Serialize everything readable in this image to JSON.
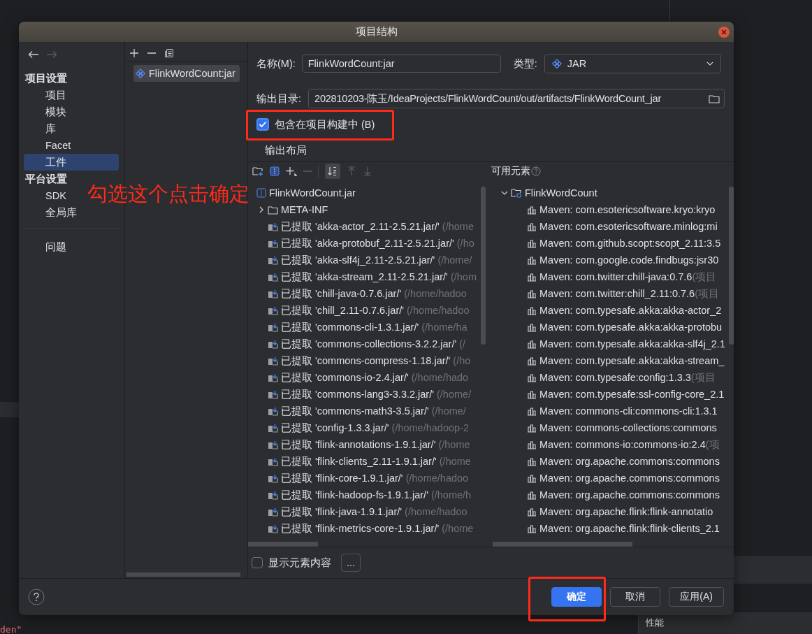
{
  "background": {
    "editor_fragment": "den\"",
    "side_panel_item": "性能"
  },
  "dialog": {
    "title": "项目结构"
  },
  "sidebar": {
    "sections": [
      {
        "heading": "项目设置",
        "items": [
          {
            "label": "项目",
            "selected": false
          },
          {
            "label": "模块",
            "selected": false
          },
          {
            "label": "库",
            "selected": false
          },
          {
            "label": "Facet",
            "selected": false
          },
          {
            "label": "工件",
            "selected": true
          }
        ]
      },
      {
        "heading": "平台设置",
        "items": [
          {
            "label": "SDK",
            "selected": false
          },
          {
            "label": "全局库",
            "selected": false
          }
        ]
      }
    ],
    "extra_items": [
      {
        "label": "问题",
        "selected": false
      }
    ]
  },
  "artifacts": [
    {
      "label": "FlinkWordCount:jar",
      "selected": true
    }
  ],
  "form": {
    "name_label": "名称(M):",
    "name_value": "FlinkWordCount:jar",
    "type_label": "类型:",
    "type_value": "JAR",
    "output_label": "输出目录:",
    "output_value": "202810203-陈玉/IdeaProjects/FlinkWordCount/out/artifacts/FlinkWordCount_jar",
    "include": {
      "label": "包含在项目构建中 (B)",
      "checked": true
    }
  },
  "layout_title": "输出布局",
  "available_title": "可用元素",
  "output_tree": {
    "label": "FlinkWordCount.jar",
    "children": [
      {
        "kind": "folder",
        "label": "META-INF",
        "expanded": false
      },
      {
        "kind": "extracted",
        "label": "已提取 'akka-actor_2.11-2.5.21.jar/'",
        "path": "(/home"
      },
      {
        "kind": "extracted",
        "label": "已提取 'akka-protobuf_2.11-2.5.21.jar/'",
        "path": "(/ho"
      },
      {
        "kind": "extracted",
        "label": "已提取 'akka-slf4j_2.11-2.5.21.jar/'",
        "path": "(/home/"
      },
      {
        "kind": "extracted",
        "label": "已提取 'akka-stream_2.11-2.5.21.jar/'",
        "path": "(/hom"
      },
      {
        "kind": "extracted",
        "label": "已提取 'chill-java-0.7.6.jar/'",
        "path": "(/home/hadoo"
      },
      {
        "kind": "extracted",
        "label": "已提取 'chill_2.11-0.7.6.jar/'",
        "path": "(/home/hadoo"
      },
      {
        "kind": "extracted",
        "label": "已提取 'commons-cli-1.3.1.jar/'",
        "path": "(/home/ha"
      },
      {
        "kind": "extracted",
        "label": "已提取 'commons-collections-3.2.2.jar/'",
        "path": "(/"
      },
      {
        "kind": "extracted",
        "label": "已提取 'commons-compress-1.18.jar/'",
        "path": "(/ho"
      },
      {
        "kind": "extracted",
        "label": "已提取 'commons-io-2.4.jar/'",
        "path": "(/home/hado"
      },
      {
        "kind": "extracted",
        "label": "已提取 'commons-lang3-3.3.2.jar/'",
        "path": "(/home/"
      },
      {
        "kind": "extracted",
        "label": "已提取 'commons-math3-3.5.jar/'",
        "path": "(/home/"
      },
      {
        "kind": "extracted",
        "label": "已提取 'config-1.3.3.jar/'",
        "path": "(/home/hadoop-2"
      },
      {
        "kind": "extracted",
        "label": "已提取 'flink-annotations-1.9.1.jar/'",
        "path": "(/home"
      },
      {
        "kind": "extracted",
        "label": "已提取 'flink-clients_2.11-1.9.1.jar/'",
        "path": "(/home"
      },
      {
        "kind": "extracted",
        "label": "已提取 'flink-core-1.9.1.jar/'",
        "path": "(/home/hadoo"
      },
      {
        "kind": "extracted",
        "label": "已提取 'flink-hadoop-fs-1.9.1.jar/'",
        "path": "(/home/h"
      },
      {
        "kind": "extracted",
        "label": "已提取 'flink-java-1.9.1.jar/'",
        "path": "(/home/hadoo"
      },
      {
        "kind": "extracted",
        "label": "已提取 'flink-metrics-core-1.9.1.jar/'",
        "path": "(/home"
      }
    ]
  },
  "available_tree": {
    "label": "FlinkWordCount",
    "expanded": true,
    "children": [
      {
        "label": "Maven: com.esotericsoftware.kryo:kryo"
      },
      {
        "label": "Maven: com.esotericsoftware.minlog:mi"
      },
      {
        "label": "Maven: com.github.scopt:scopt_2.11:3.5"
      },
      {
        "label": "Maven: com.google.code.findbugs:jsr30"
      },
      {
        "label": "Maven: com.twitter:chill-java:0.7.6",
        "note": "(项目"
      },
      {
        "label": "Maven: com.twitter:chill_2.11:0.7.6",
        "note": "(项目"
      },
      {
        "label": "Maven: com.typesafe.akka:akka-actor_2"
      },
      {
        "label": "Maven: com.typesafe.akka:akka-protobu"
      },
      {
        "label": "Maven: com.typesafe.akka:akka-slf4j_2.1"
      },
      {
        "label": "Maven: com.typesafe.akka:akka-stream_"
      },
      {
        "label": "Maven: com.typesafe:config:1.3.3",
        "note": "(项目"
      },
      {
        "label": "Maven: com.typesafe:ssl-config-core_2.1"
      },
      {
        "label": "Maven: commons-cli:commons-cli:1.3.1"
      },
      {
        "label": "Maven: commons-collections:commons"
      },
      {
        "label": "Maven: commons-io:commons-io:2.4",
        "note": "(项"
      },
      {
        "label": "Maven: org.apache.commons:commons"
      },
      {
        "label": "Maven: org.apache.commons:commons"
      },
      {
        "label": "Maven: org.apache.commons:commons"
      },
      {
        "label": "Maven: org.apache.flink:flink-annotatio"
      },
      {
        "label": "Maven: org.apache.flink:flink-clients_2.1"
      }
    ]
  },
  "show_content": {
    "label": "显示元素内容",
    "checked": false
  },
  "more_button": "...",
  "buttons": [
    {
      "label": "确定",
      "primary": true
    },
    {
      "label": "取消",
      "primary": false
    },
    {
      "label": "应用(A)",
      "primary": false
    }
  ],
  "annotation": {
    "text": "勾选这个点击确定"
  }
}
